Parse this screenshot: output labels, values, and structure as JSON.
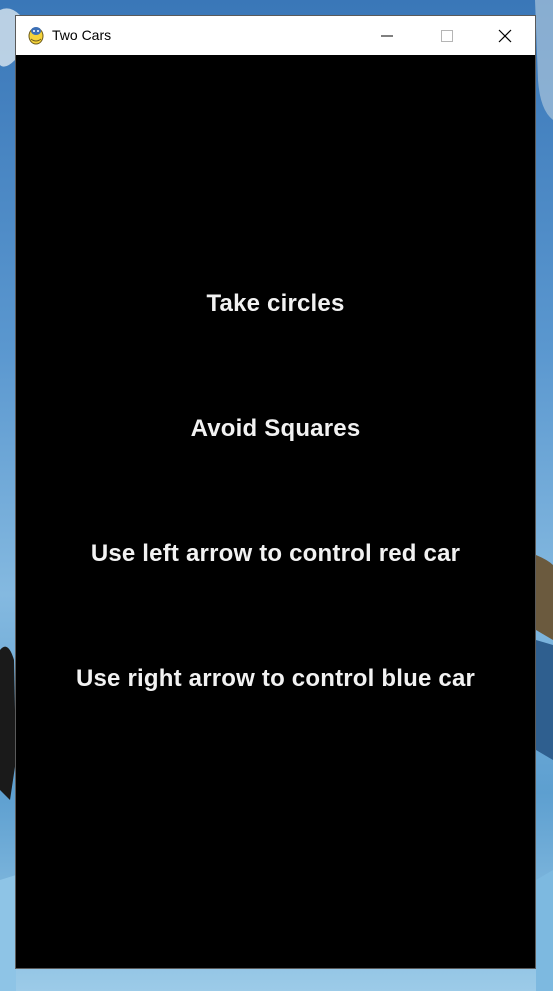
{
  "window": {
    "title": "Two Cars",
    "icon": "pygame-snake-icon",
    "controls": {
      "minimize_icon": "minimize-icon",
      "maximize_icon": "maximize-icon",
      "close_icon": "close-icon"
    }
  },
  "instructions": {
    "line1": "Take circles",
    "line2": "Avoid Squares",
    "line3": "Use left arrow to control red car",
    "line4": "Use right arrow to control blue car"
  },
  "colors": {
    "game_background": "#000000",
    "text": "#f2f2f2",
    "titlebar": "#ffffff"
  }
}
